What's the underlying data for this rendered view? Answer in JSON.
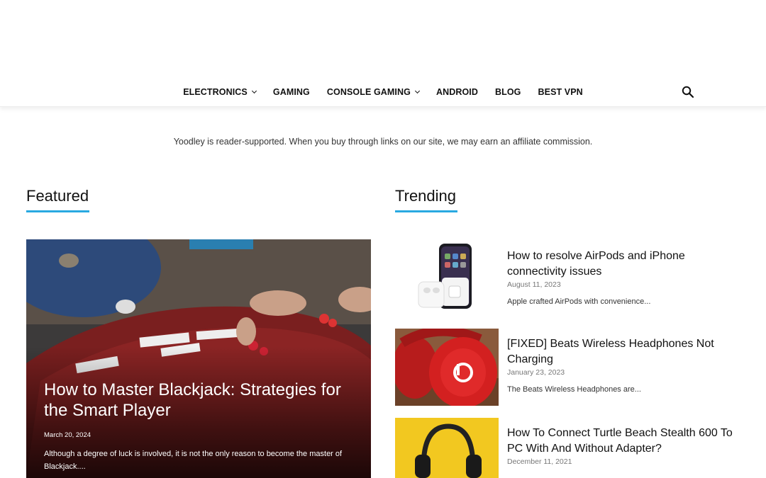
{
  "nav": {
    "items": [
      {
        "label": "ELECTRONICS",
        "dropdown": true
      },
      {
        "label": "GAMING",
        "dropdown": false
      },
      {
        "label": "CONSOLE GAMING",
        "dropdown": true
      },
      {
        "label": "ANDROID",
        "dropdown": false
      },
      {
        "label": "BLOG",
        "dropdown": false
      },
      {
        "label": "BEST VPN",
        "dropdown": false
      }
    ],
    "search_icon": "search-icon"
  },
  "disclosure": "Yoodley is reader-supported. When you buy through links on our site, we may earn an affiliate commission.",
  "featured": {
    "heading": "Featured",
    "post": {
      "title": "How to Master Blackjack: Strategies for the Smart Player",
      "date": "March 20, 2024",
      "excerpt": "Although a degree of luck is involved, it is not the only reason to become the master of Blackjack...."
    }
  },
  "trending": {
    "heading": "Trending",
    "posts": [
      {
        "title": "How to resolve AirPods and iPhone connectivity issues",
        "date": "August 11, 2023",
        "excerpt": "Apple crafted AirPods with convenience..."
      },
      {
        "title": "[FIXED] Beats Wireless Headphones Not Charging",
        "date": "January 23, 2023",
        "excerpt": "The Beats Wireless Headphones are..."
      },
      {
        "title": "How To Connect Turtle Beach Stealth 600 To PC With And Without Adapter?",
        "date": "December 11, 2021",
        "excerpt": ""
      }
    ]
  },
  "colors": {
    "accent": "#29a9e1",
    "nav_text": "#111111"
  }
}
